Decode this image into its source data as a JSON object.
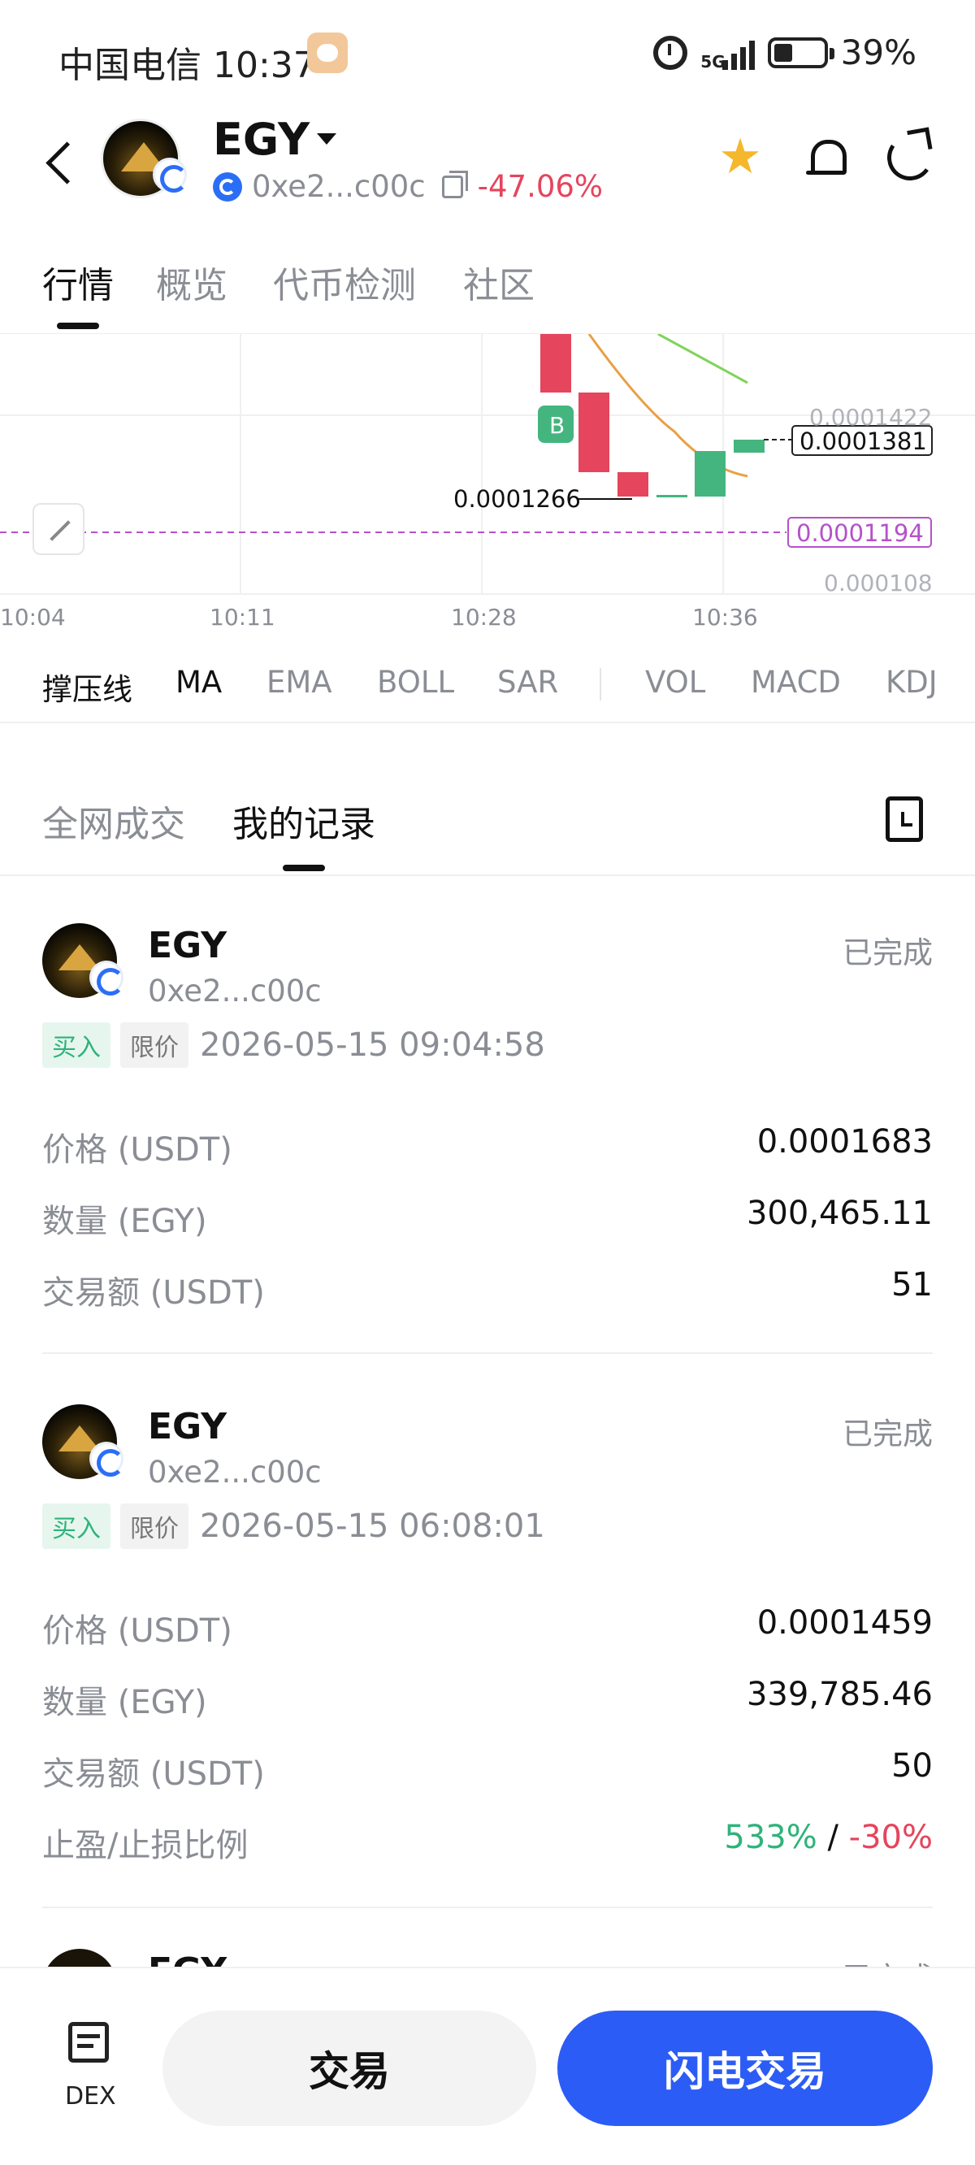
{
  "status_bar": {
    "carrier_time": "中国电信 10:37",
    "network": "5G",
    "battery": "39%"
  },
  "header": {
    "token": "EGY",
    "address": "0xe2...c00c",
    "change": "-47.06%",
    "colors": {
      "negative": "#e5455d",
      "positive": "#2fb37a",
      "star": "#f5b72b",
      "primary": "#2c5cf6"
    }
  },
  "main_tabs": [
    "行情",
    "概览",
    "代币检测",
    "社区"
  ],
  "chart": {
    "price_marker_b": "B",
    "low_label": "0.0001266",
    "current_price": "0.0001381",
    "limit_price": "0.0001194",
    "y_ticks": [
      "0.0001422",
      "0.000108"
    ],
    "x_ticks": [
      "10:04",
      "10:11",
      "10:28",
      "10:36"
    ]
  },
  "chart_data": {
    "type": "line",
    "x": [
      "10:04",
      "10:11",
      "10:28",
      "10:36"
    ],
    "series": [],
    "candles": [
      {
        "o": 0.00015,
        "c": 0.000143,
        "dir": "down"
      },
      {
        "o": 0.000143,
        "c": 0.000131,
        "dir": "down"
      },
      {
        "o": 0.00013,
        "c": 0.000127,
        "dir": "down"
      },
      {
        "o": 0.000127,
        "c": 0.000127,
        "dir": "flat"
      },
      {
        "o": 0.000127,
        "c": 0.000133,
        "dir": "up"
      },
      {
        "o": 0.000137,
        "c": 0.000138,
        "dir": "up"
      }
    ],
    "yticks": [
      0.0001422,
      0.000108
    ],
    "markers": {
      "current": 0.0001381,
      "limit": 0.0001194,
      "low": 0.0001266
    }
  },
  "indicators": {
    "label": "撑压线",
    "items": [
      "MA",
      "EMA",
      "BOLL",
      "SAR",
      "VOL",
      "MACD",
      "KDJ"
    ]
  },
  "trade_tabs": [
    "全网成交",
    "我的记录"
  ],
  "records": [
    {
      "token": "EGY",
      "address": "0xe2...c00c",
      "status": "已完成",
      "side": "买入",
      "order_type": "限价",
      "time": "2026-05-15 09:04:58",
      "rows": [
        {
          "label": "价格 (USDT)",
          "value": "0.0001683"
        },
        {
          "label": "数量 (EGY)",
          "value": "300,465.11"
        },
        {
          "label": "交易额 (USDT)",
          "value": "51"
        }
      ]
    },
    {
      "token": "EGY",
      "address": "0xe2...c00c",
      "status": "已完成",
      "side": "买入",
      "order_type": "限价",
      "time": "2026-05-15 06:08:01",
      "rows": [
        {
          "label": "价格 (USDT)",
          "value": "0.0001459"
        },
        {
          "label": "数量 (EGY)",
          "value": "339,785.46"
        },
        {
          "label": "交易额 (USDT)",
          "value": "50"
        }
      ],
      "tp_sl": {
        "label": "止盈/止损比例",
        "tp": "533%",
        "sep": "/",
        "sl": "-30%"
      }
    },
    {
      "token": "EGY",
      "status": "已完成"
    }
  ],
  "bottom": {
    "dex": "DEX",
    "trade": "交易",
    "flash_trade": "闪电交易"
  }
}
